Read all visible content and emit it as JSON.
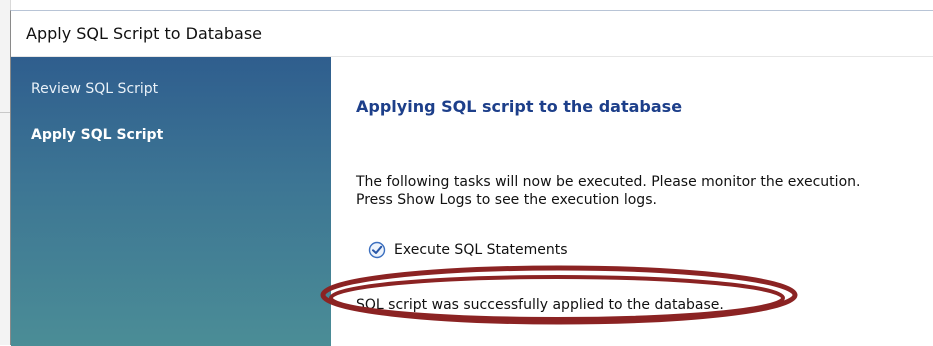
{
  "dialog": {
    "title": "Apply SQL Script to Database"
  },
  "sidebar": {
    "items": [
      {
        "label": "Review SQL Script",
        "active": false
      },
      {
        "label": "Apply SQL Script",
        "active": true
      }
    ]
  },
  "main": {
    "heading": "Applying SQL script to the database",
    "description_line1": "The following tasks will now be executed. Please monitor the execution.",
    "description_line2": "Press Show Logs to see the execution logs.",
    "tasks": [
      {
        "label": "Execute SQL Statements",
        "icon": "check-circle-icon",
        "status": "done"
      }
    ],
    "status_message": "SQL script was successfully applied to the database."
  },
  "colors": {
    "heading": "#1d3f8a",
    "sidebar_top": "#2f5e8e",
    "sidebar_bottom": "#4b8d96",
    "highlight_ring": "#8b2323",
    "check": "#3b6fbf"
  }
}
